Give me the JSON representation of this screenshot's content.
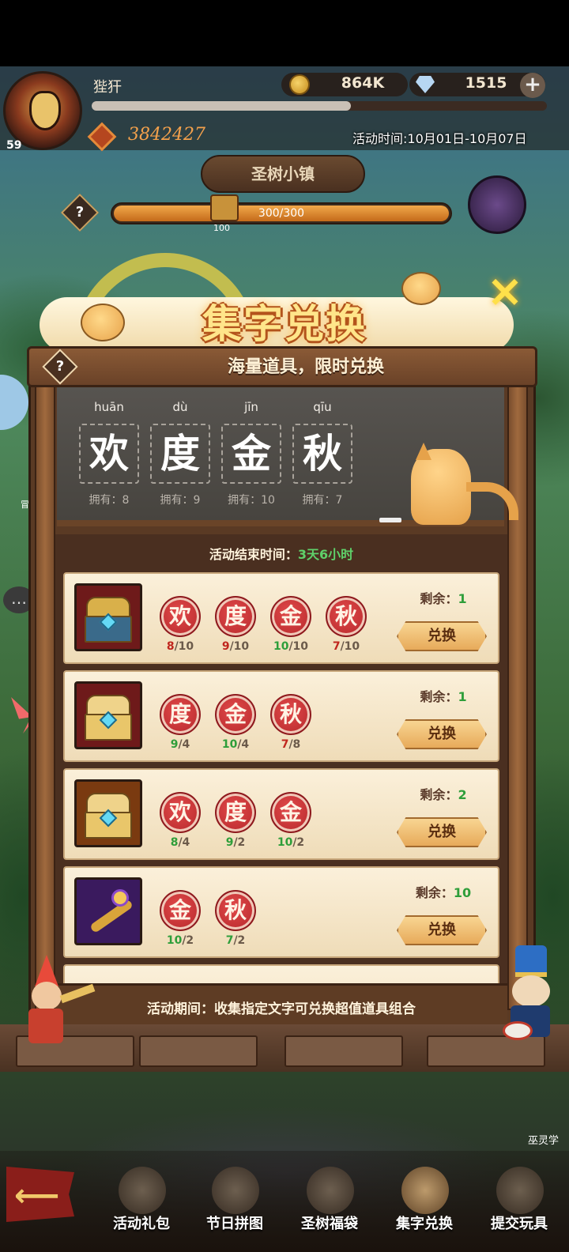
{
  "hud": {
    "player_name": "狴犴",
    "level": "59",
    "power": "3842427",
    "xp_fraction": 0.57,
    "coins": "864K",
    "gems": "1515",
    "plus": "+",
    "event_time": "活动时间:10月01日-10月07日"
  },
  "town": {
    "tab_label": "圣树小镇",
    "help": "?",
    "progress_text": "300/300",
    "progress_fraction": 1.0,
    "chest_label": "100"
  },
  "panel": {
    "title": "集字兑换",
    "close": "×",
    "subtitle": "海量道具，限时兑换",
    "help": "?",
    "characters": [
      {
        "pinyin": "huān",
        "char": "欢",
        "owned": "拥有：8"
      },
      {
        "pinyin": "dù",
        "char": "度",
        "owned": "拥有：9"
      },
      {
        "pinyin": "jīn",
        "char": "金",
        "owned": "拥有：10"
      },
      {
        "pinyin": "qīu",
        "char": "秋",
        "owned": "拥有：7"
      }
    ],
    "end_label": "活动结束时间：",
    "end_value": "3天6小时",
    "remain_label": "剩余：",
    "exchange_label": "兑换",
    "rewards": [
      {
        "icon": "golden-chest-icon",
        "icon_bg": "#6e1a1a",
        "remaining": "1",
        "requirements": [
          {
            "char": "欢",
            "have": "8",
            "need": "/10",
            "met": false
          },
          {
            "char": "度",
            "have": "9",
            "need": "/10",
            "met": false
          },
          {
            "char": "金",
            "have": "10",
            "need": "/10",
            "met": true
          },
          {
            "char": "秋",
            "have": "7",
            "need": "/10",
            "met": false
          }
        ]
      },
      {
        "icon": "gold-cube-chest-icon",
        "icon_bg": "#6e1a1a",
        "remaining": "1",
        "requirements": [
          {
            "char": "度",
            "have": "9",
            "need": "/4",
            "met": true
          },
          {
            "char": "金",
            "have": "10",
            "need": "/4",
            "met": true
          },
          {
            "char": "秋",
            "have": "7",
            "need": "/8",
            "met": false
          }
        ]
      },
      {
        "icon": "gold-cube-chest-icon",
        "icon_bg": "#7a3a10",
        "remaining": "2",
        "requirements": [
          {
            "char": "欢",
            "have": "8",
            "need": "/4",
            "met": true
          },
          {
            "char": "度",
            "have": "9",
            "need": "/2",
            "met": true
          },
          {
            "char": "金",
            "have": "10",
            "need": "/2",
            "met": true
          }
        ]
      },
      {
        "icon": "golden-staff-icon",
        "icon_bg": "#3a1a5e",
        "remaining": "10",
        "requirements": [
          {
            "char": "金",
            "have": "10",
            "need": "/2",
            "met": true
          },
          {
            "char": "秋",
            "have": "7",
            "need": "/2",
            "met": true
          }
        ]
      }
    ],
    "footer": "活动期间：收集指定文字可兑换超值道具组合"
  },
  "side": {
    "left_label": "冒险",
    "right_label": "巫灵学"
  },
  "nav": {
    "back": "back-arrow-icon",
    "items": [
      {
        "label": "活动礼包",
        "icon": "gift-box-icon",
        "active": false
      },
      {
        "label": "节日拼图",
        "icon": "puzzle-icon",
        "active": false
      },
      {
        "label": "圣树福袋",
        "icon": "lucky-bag-icon",
        "active": false
      },
      {
        "label": "集字兑换",
        "icon": "word-exchange-icon",
        "active": true
      },
      {
        "label": "提交玩具",
        "icon": "toy-clown-icon",
        "active": false
      }
    ]
  },
  "colors": {
    "met": "#2e9e3a",
    "unmet": "#c0261e",
    "title": "#ffe58a",
    "seal": "#c8302e"
  }
}
